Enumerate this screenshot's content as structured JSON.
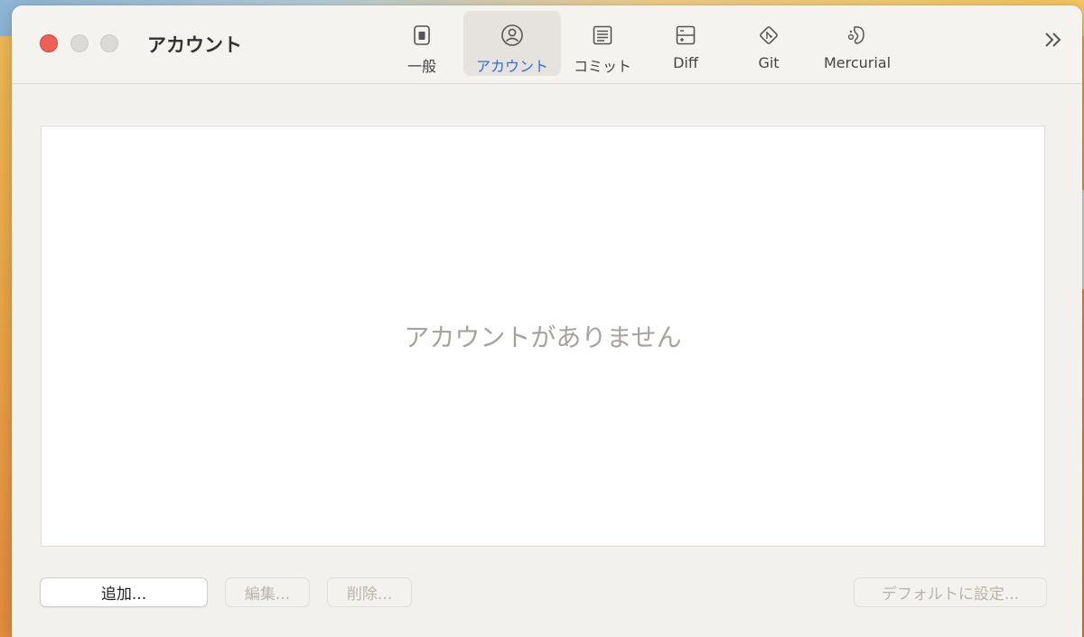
{
  "window": {
    "title": "アカウント"
  },
  "toolbar": {
    "tabs": [
      {
        "label": "一般",
        "icon": "switch-icon"
      },
      {
        "label": "アカウント",
        "icon": "person-circle-icon"
      },
      {
        "label": "コミット",
        "icon": "document-lines-icon"
      },
      {
        "label": "Diff",
        "icon": "plus-minus-doc-icon"
      },
      {
        "label": "Git",
        "icon": "git-diamond-icon"
      },
      {
        "label": "Mercurial",
        "icon": "mercurial-icon"
      }
    ],
    "active_index": 1,
    "accent_color": "#2f6fd8"
  },
  "main": {
    "empty_message": "アカウントがありません"
  },
  "footer": {
    "add_label": "追加...",
    "edit_label": "編集...",
    "delete_label": "削除...",
    "default_label": "デフォルトに設定..."
  }
}
